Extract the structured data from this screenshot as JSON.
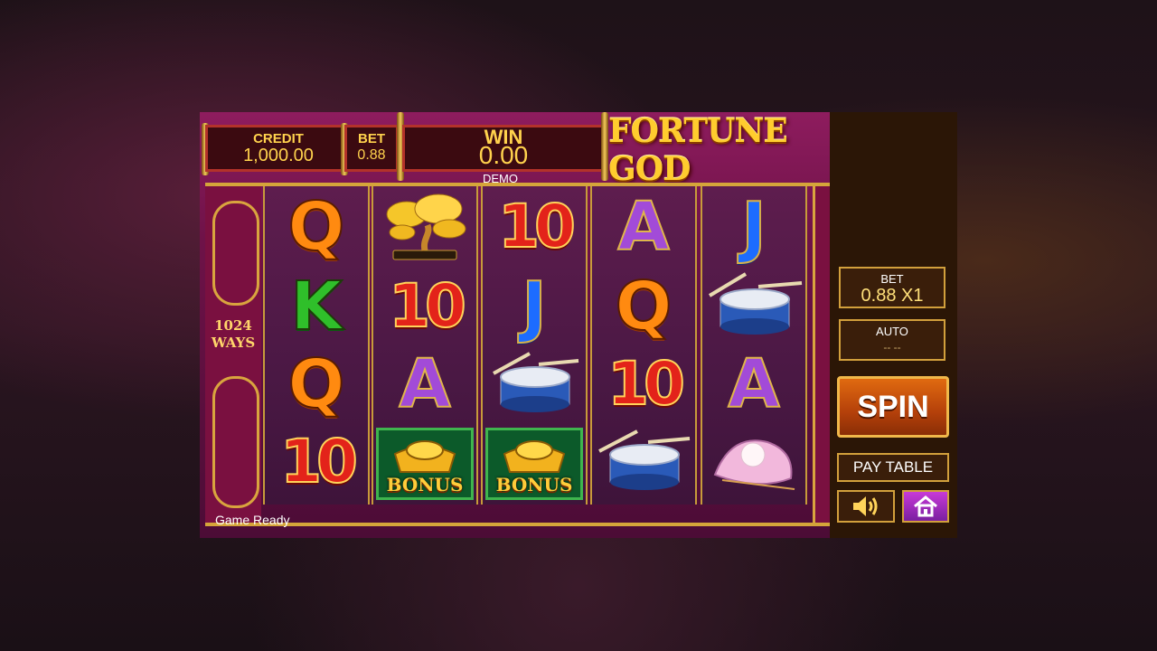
{
  "game": {
    "title": "FORTUNE GOD",
    "credit_label": "CREDIT",
    "credit_value": "1,000.00",
    "bet_label": "BET",
    "bet_value": "0.88",
    "win_label": "WIN",
    "win_value": "0.00",
    "mode": "DEMO",
    "ways_line1": "1024",
    "ways_line2": "WAYS",
    "status": "Game Ready"
  },
  "reels": [
    [
      "letter-Q",
      "golden-bonsai-icon",
      "letter-Q",
      "ten"
    ],
    [
      "ten-top",
      "ten",
      "letter-A",
      "bonus"
    ],
    [
      "ten",
      "letter-J",
      "drum-icon",
      "bonus"
    ],
    [
      "letter-A",
      "letter-Q",
      "ten",
      "drum-icon"
    ],
    [
      "letter-J",
      "drum-icon",
      "letter-A",
      "pearl-shell-icon"
    ]
  ],
  "symbols": {
    "Q": "Q",
    "K": "K",
    "A": "A",
    "J": "J",
    "ten": "10",
    "bonus": "BONUS"
  },
  "sidebar": {
    "bet_label": "BET",
    "bet_value": "0.88 X1",
    "auto_label": "AUTO",
    "auto_value": "-- --",
    "spin_label": "SPIN",
    "paytable_label": "PAY TABLE",
    "sound_icon": "speaker-icon",
    "home_icon": "home-icon"
  },
  "colors": {
    "accent_gold": "#d2a03c",
    "stage_magenta": "#8e1c5e",
    "spin_orange": "#e06a10"
  }
}
